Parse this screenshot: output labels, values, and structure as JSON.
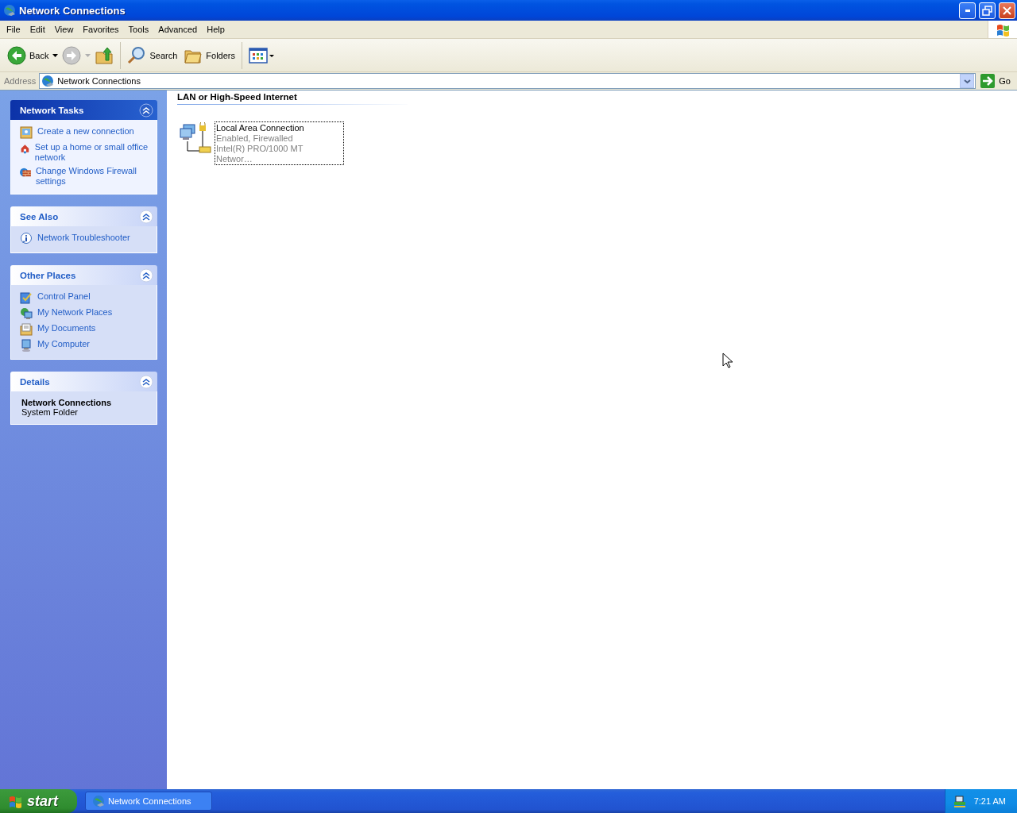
{
  "window": {
    "title": "Network Connections"
  },
  "menu": [
    "File",
    "Edit",
    "View",
    "Favorites",
    "Tools",
    "Advanced",
    "Help"
  ],
  "toolbar": {
    "back": {
      "label": "Back"
    },
    "forward": {
      "disabled": true
    },
    "search": {
      "label": "Search"
    },
    "folders": {
      "label": "Folders"
    }
  },
  "address": {
    "label": "Address",
    "value": "Network Connections",
    "go": "Go"
  },
  "sidebar": {
    "panels": [
      {
        "title": "Network Tasks",
        "kind": "special",
        "expanded": true,
        "items": [
          "Create a new connection",
          "Set up a home or small office network",
          "Change Windows Firewall settings"
        ]
      },
      {
        "title": "See Also",
        "kind": "normal",
        "expanded": true,
        "items": [
          "Network Troubleshooter"
        ]
      },
      {
        "title": "Other Places",
        "kind": "normal",
        "expanded": true,
        "items": [
          "Control Panel",
          "My Network Places",
          "My Documents",
          "My Computer"
        ]
      },
      {
        "title": "Details",
        "kind": "normal",
        "expanded": true,
        "details": {
          "name": "Network Connections",
          "type": "System Folder"
        }
      }
    ]
  },
  "content": {
    "group": "LAN or High-Speed Internet",
    "connections": [
      {
        "name": "Local Area Connection",
        "status": "Enabled, Firewalled",
        "device": "Intel(R) PRO/1000 MT Networ…",
        "selected": true
      }
    ]
  },
  "taskbar": {
    "start": "start",
    "tasks": [
      {
        "label": "Network Connections",
        "selected": false
      }
    ],
    "clock": "7:21 AM"
  }
}
